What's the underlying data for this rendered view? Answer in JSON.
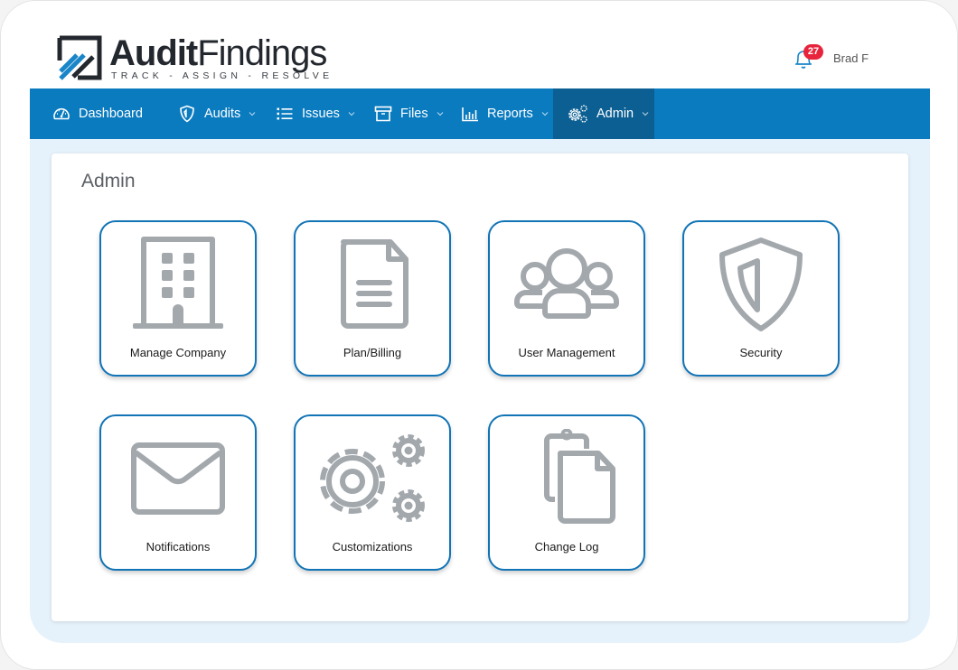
{
  "header": {
    "logo": {
      "brand_bold": "Audit",
      "brand_light": "Findings",
      "tagline": "TRACK - ASSIGN - RESOLVE"
    },
    "notifications": {
      "count": "27",
      "icon": "bell-icon"
    },
    "user": {
      "name": "Brad F"
    }
  },
  "nav": {
    "items": [
      {
        "label": "Dashboard",
        "icon": "dashboard-gauge-icon",
        "has_dropdown": false
      },
      {
        "label": "Audits",
        "icon": "shield-icon",
        "has_dropdown": true
      },
      {
        "label": "Issues",
        "icon": "list-icon",
        "has_dropdown": true
      },
      {
        "label": "Files",
        "icon": "archive-box-icon",
        "has_dropdown": true
      },
      {
        "label": "Reports",
        "icon": "bar-chart-icon",
        "has_dropdown": true
      },
      {
        "label": "Admin",
        "icon": "gears-icon",
        "has_dropdown": true,
        "active": true
      }
    ]
  },
  "page": {
    "title": "Admin",
    "tiles": [
      {
        "label": "Manage Company",
        "icon": "building-icon"
      },
      {
        "label": "Plan/Billing",
        "icon": "document-icon"
      },
      {
        "label": "User Management",
        "icon": "users-icon"
      },
      {
        "label": "Security",
        "icon": "shield-icon"
      },
      {
        "label": "Notifications",
        "icon": "envelope-icon"
      },
      {
        "label": "Customizations",
        "icon": "gears-icon"
      },
      {
        "label": "Change Log",
        "icon": "copy-documents-icon"
      }
    ]
  },
  "colors": {
    "nav_bg": "#0a7bbf",
    "nav_active": "#0b5f93",
    "tile_border": "#1174b6",
    "icon_gray": "#a3a8ad",
    "badge": "#e8243c",
    "content_bg": "#e6f2fb"
  }
}
